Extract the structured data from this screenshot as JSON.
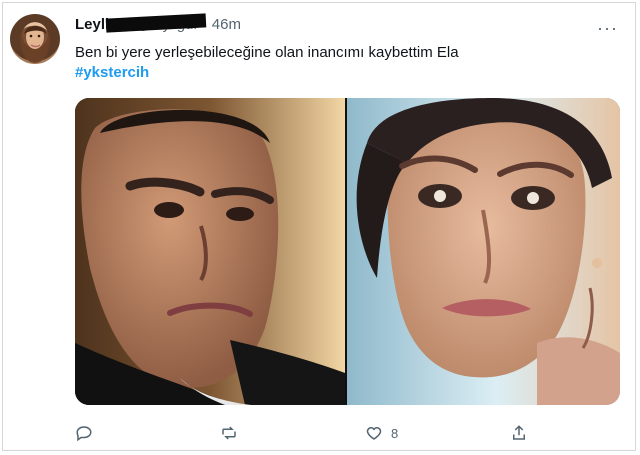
{
  "tweet": {
    "display_name": "Leyligül",
    "handle": "@leyligül",
    "dot": "·",
    "time": "46m",
    "text": "Ben bi yere yerleşebileceğine olan inancımı kaybettim Ela",
    "hashtag": "#ykstercih",
    "more_label": "···",
    "actions": {
      "reply_icon": "reply-icon",
      "retweet_icon": "retweet-icon",
      "like_icon": "like-icon",
      "like_count": "8",
      "share_icon": "share-icon"
    }
  },
  "colors": {
    "link": "#1d9bf0",
    "text": "#0f1419",
    "secondary": "#536471"
  }
}
